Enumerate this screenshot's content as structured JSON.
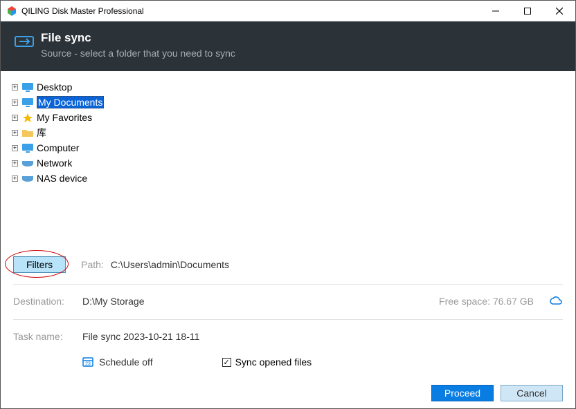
{
  "titlebar": {
    "title": "QILING Disk Master Professional"
  },
  "header": {
    "title": "File sync",
    "subtitle": "Source - select a folder that you need to sync"
  },
  "tree": {
    "items": [
      {
        "label": "Desktop",
        "icon": "monitor"
      },
      {
        "label": "My Documents",
        "icon": "monitor",
        "selected": true
      },
      {
        "label": "My Favorites",
        "icon": "star"
      },
      {
        "label": "库",
        "icon": "folder"
      },
      {
        "label": "Computer",
        "icon": "monitor"
      },
      {
        "label": "Network",
        "icon": "drive"
      },
      {
        "label": "NAS device",
        "icon": "drive"
      }
    ]
  },
  "filters": {
    "label": "Filters"
  },
  "path": {
    "label": "Path:",
    "value": "C:\\Users\\admin\\Documents"
  },
  "destination": {
    "label": "Destination:",
    "value": "D:\\My Storage",
    "free_space": "Free space: 76.67 GB"
  },
  "task": {
    "label": "Task name:",
    "value": "File sync 2023-10-21 18-11"
  },
  "options": {
    "schedule": "Schedule off",
    "sync_opened": "Sync opened files",
    "sync_checked": true
  },
  "buttons": {
    "proceed": "Proceed",
    "cancel": "Cancel"
  }
}
